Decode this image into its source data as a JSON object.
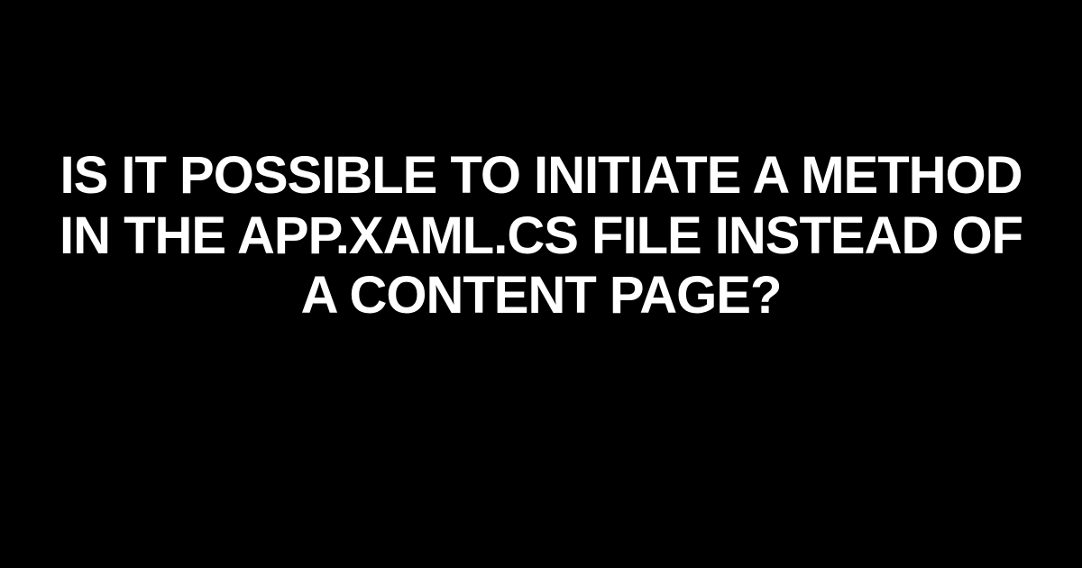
{
  "headline": "IS IT POSSIBLE TO INITIATE A METHOD IN THE APP.XAML.CS FILE INSTEAD OF A CONTENT PAGE?"
}
